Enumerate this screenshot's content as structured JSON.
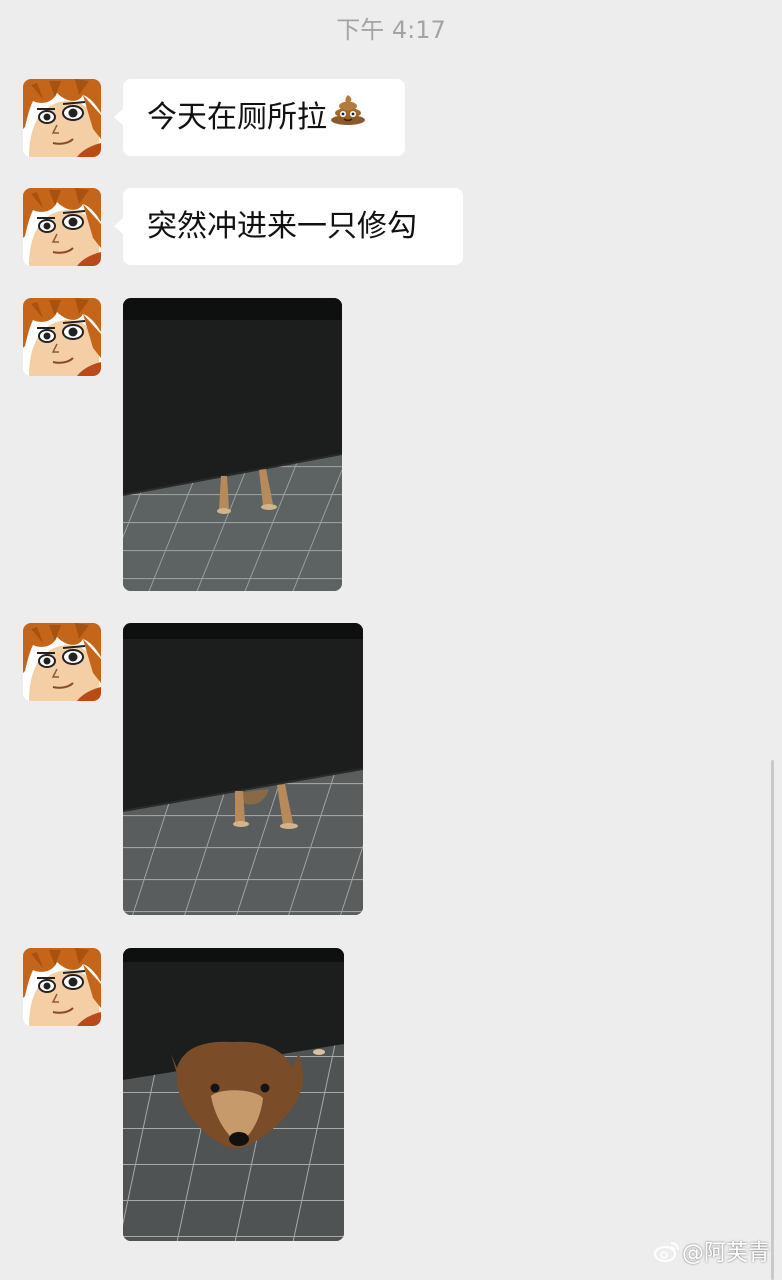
{
  "chat": {
    "timestamp": "下午 4:17",
    "messages": [
      {
        "type": "text",
        "text": "今天在厕所拉",
        "emoji": "poop-emoji"
      },
      {
        "type": "text",
        "text": "突然冲进来一只修勾"
      },
      {
        "type": "image",
        "description_icon": "photo-dog-paws-under-door"
      },
      {
        "type": "image",
        "description_icon": "photo-dog-paws-under-door"
      },
      {
        "type": "image",
        "description_icon": "photo-dog-face-under-door"
      }
    ]
  },
  "watermark": {
    "text": "@阿芙青",
    "icon": "weibo-icon"
  },
  "colors": {
    "background": "#ededed",
    "bubble": "#ffffff",
    "timestamp": "#a4a4a4"
  }
}
